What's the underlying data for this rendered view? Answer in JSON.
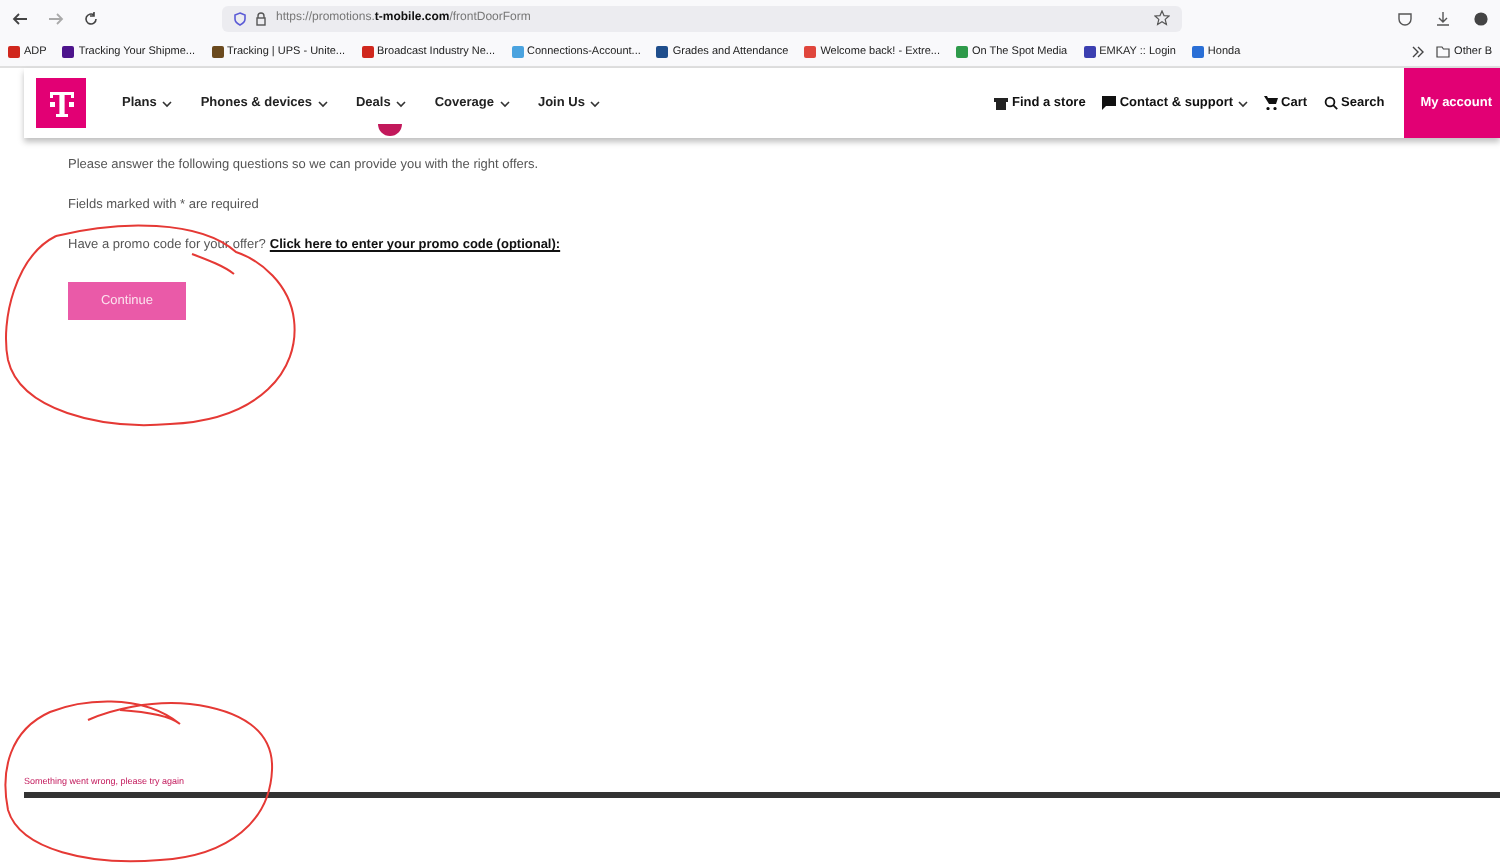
{
  "browser": {
    "url": "https://promotions.**t-mobile.com**/frontDoorForm",
    "bookmarks": [
      {
        "label": "ADP",
        "color": "#d0271d"
      },
      {
        "label": "Tracking Your Shipme...",
        "color": "#4d148c"
      },
      {
        "label": "Tracking | UPS - Unite...",
        "color": "#6b4a1e"
      },
      {
        "label": "Broadcast Industry Ne...",
        "color": "#d0271d"
      },
      {
        "label": "Connections-Account...",
        "color": "#4aa3df"
      },
      {
        "label": "Grades and Attendance",
        "color": "#1f4e8c"
      },
      {
        "label": "Welcome back! - Extre...",
        "color": "#e0463c"
      },
      {
        "label": "On The Spot Media",
        "color": "#2e9a4a"
      },
      {
        "label": "EMKAY :: Login",
        "color": "#3b3fb0"
      },
      {
        "label": "Honda",
        "color": "#2a6fd6"
      }
    ],
    "other_bookmarks": "Other B"
  },
  "header": {
    "nav": [
      {
        "label": "Plans",
        "has_menu": true
      },
      {
        "label": "Phones & devices",
        "has_menu": true
      },
      {
        "label": "Deals",
        "has_menu": true
      },
      {
        "label": "Coverage",
        "has_menu": true
      },
      {
        "label": "Join Us",
        "has_menu": true
      }
    ],
    "utility": [
      {
        "kind": "store",
        "label": "Find a store",
        "has_menu": false
      },
      {
        "kind": "chat",
        "label": "Contact & support",
        "has_menu": true
      },
      {
        "kind": "cart",
        "label": "Cart",
        "has_menu": false
      },
      {
        "kind": "search",
        "label": "Search",
        "has_menu": false
      }
    ],
    "account_button": "My account"
  },
  "form": {
    "intro": "Please answer the following questions so we can provide you with the right offers.",
    "required_note": "Fields marked with * are required",
    "promo_question": "Have a promo code for your offer?",
    "promo_link": "Click here to enter your promo code (optional):",
    "continue_button": "Continue",
    "error_message": "Something went wrong, please try again"
  }
}
